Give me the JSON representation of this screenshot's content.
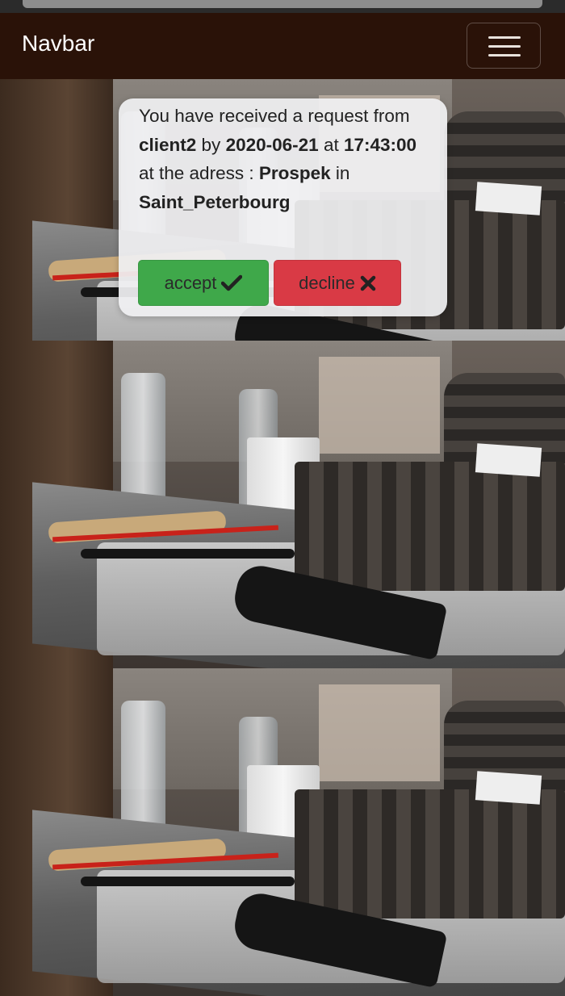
{
  "navbar": {
    "brand": "Navbar",
    "toggle_icon": "hamburger-menu-icon"
  },
  "request": {
    "line_prefix": "You have received a request from",
    "client": "client2",
    "by_word": "by",
    "date": "2020-06-21",
    "at_word": "at",
    "time": "17:43:00",
    "address_phrase": "at the adress :",
    "address": "Prospek",
    "in_word": "in",
    "city": "Saint_Peterbourg"
  },
  "actions": {
    "accept_label": "accept",
    "accept_icon": "check-icon",
    "decline_label": "decline",
    "decline_icon": "x-icon"
  },
  "colors": {
    "navbar_bg": "#2a1208",
    "accept": "#3fa84a",
    "decline": "#d93a45"
  }
}
